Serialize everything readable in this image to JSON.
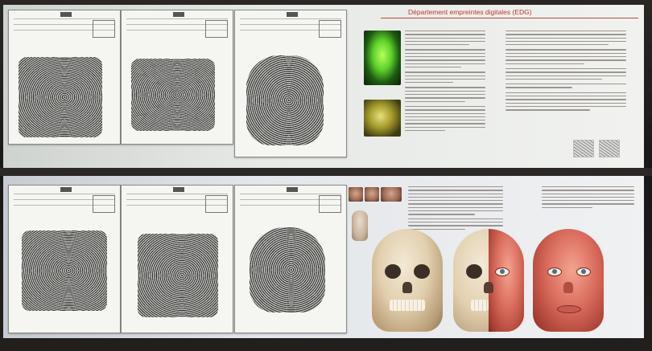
{
  "exhibit": {
    "top_title": "Département empreintes digitales (EDG)"
  },
  "cards_top": [
    {
      "name": "fingerprint-card-1"
    },
    {
      "name": "fingerprint-card-2"
    },
    {
      "name": "fingerprint-card-3"
    }
  ],
  "cards_bottom": [
    {
      "name": "fingerprint-card-4"
    },
    {
      "name": "fingerprint-card-5"
    },
    {
      "name": "fingerprint-card-6"
    }
  ],
  "colors": {
    "title_red": "#c0392b",
    "panel_top": "#e6e9e6",
    "panel_bottom": "#e3e6ea",
    "frame": "#1c1a19"
  }
}
